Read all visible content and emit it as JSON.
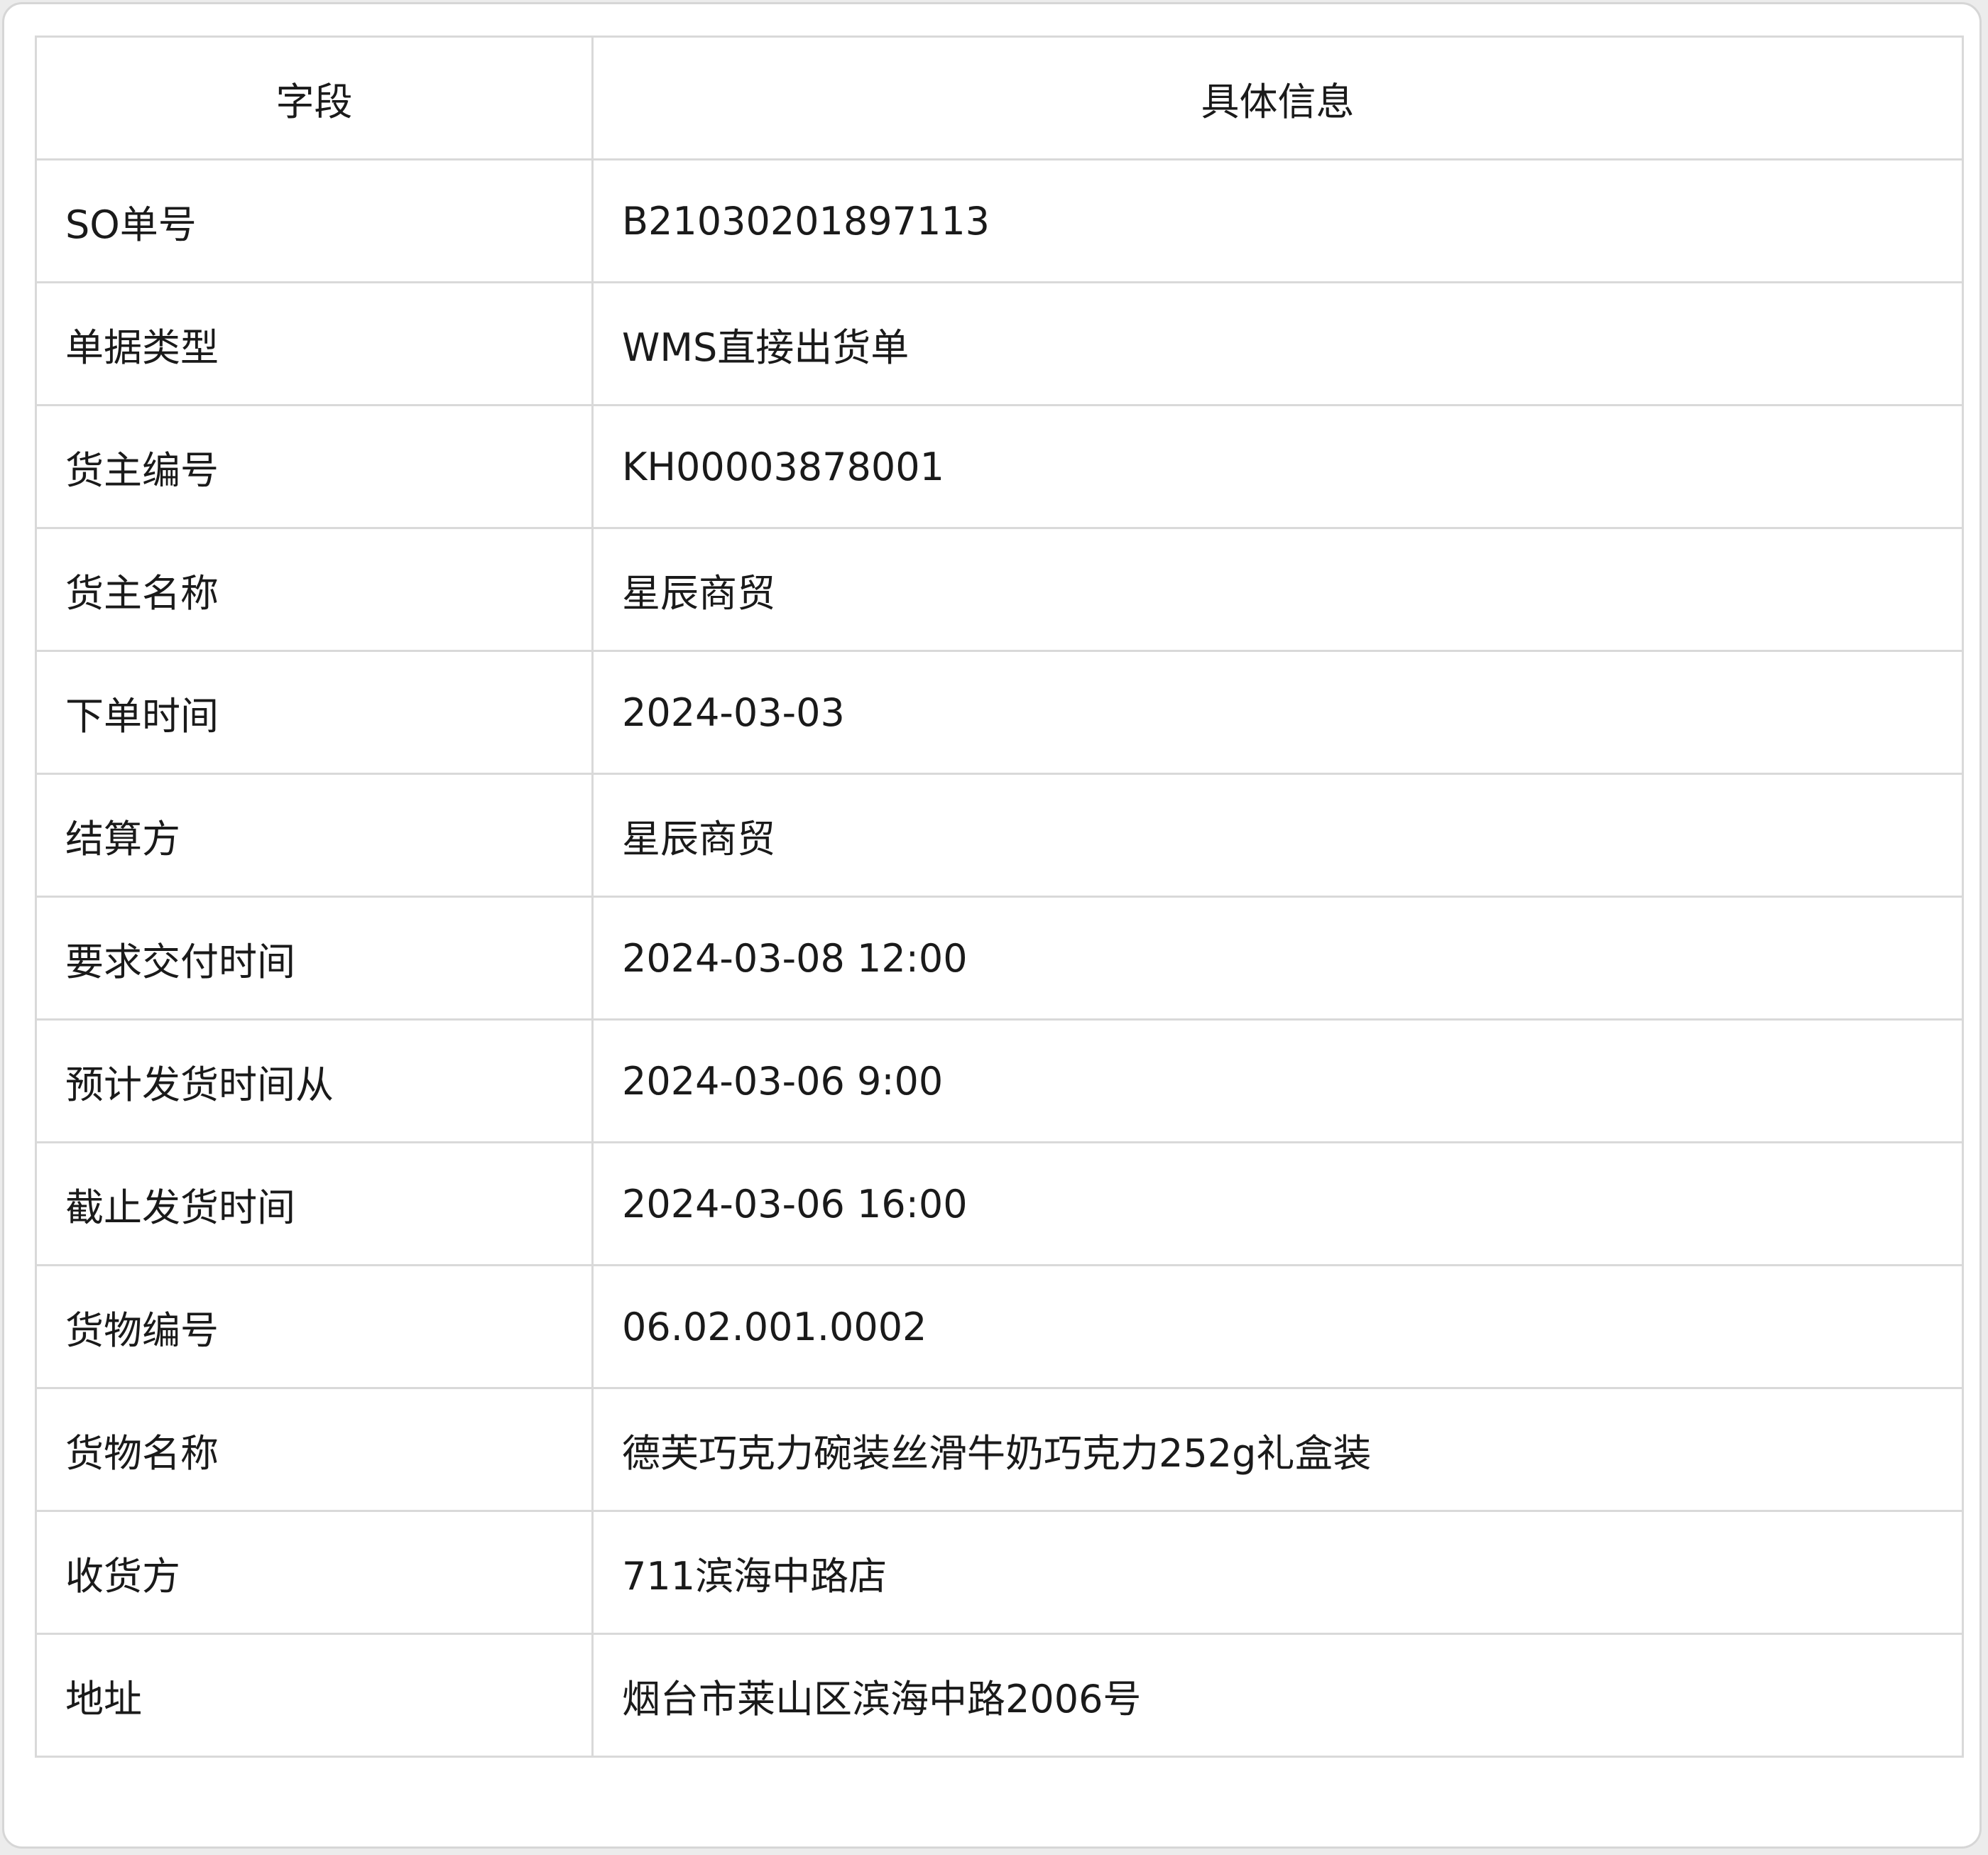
{
  "table": {
    "headers": [
      "字段",
      "具体信息"
    ],
    "rows": [
      {
        "field": "SO单号",
        "value": "B21030201897113"
      },
      {
        "field": "单据类型",
        "value": "WMS直接出货单"
      },
      {
        "field": "货主编号",
        "value": "KH00003878001"
      },
      {
        "field": "货主名称",
        "value": "星辰商贸"
      },
      {
        "field": "下单时间",
        "value": "2024-03-03"
      },
      {
        "field": "结算方",
        "value": "星辰商贸"
      },
      {
        "field": "要求交付时间",
        "value": "2024-03-08 12:00"
      },
      {
        "field": "预计发货时间从",
        "value": "2024-03-06 9:00"
      },
      {
        "field": "截止发货时间",
        "value": "2024-03-06 16:00"
      },
      {
        "field": "货物编号",
        "value": "06.02.001.0002"
      },
      {
        "field": "货物名称",
        "value": "德芙巧克力碗装丝滑牛奶巧克力252g礼盒装"
      },
      {
        "field": "收货方",
        "value": "711滨海中路店"
      },
      {
        "field": "地址",
        "value": "烟台市莱山区滨海中路2006号"
      }
    ]
  }
}
